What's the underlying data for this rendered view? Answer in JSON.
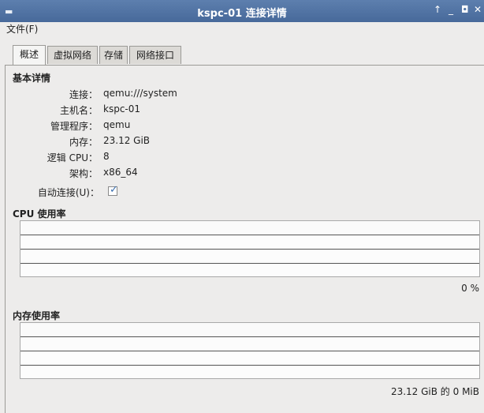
{
  "window": {
    "title": "kspc-01 连接详情",
    "menu_icon": "menu-icon",
    "controls": [
      "↑",
      "_",
      "◘",
      "✕"
    ]
  },
  "menubar": {
    "file": "文件(F)"
  },
  "tabs": [
    "概述",
    "虚拟网络",
    "存储",
    "网络接口"
  ],
  "basic": {
    "title": "基本详情",
    "rows": [
      {
        "label": "连接：",
        "value": "qemu:///system"
      },
      {
        "label": "主机名：",
        "value": "kspc-01"
      },
      {
        "label": "管理程序：",
        "value": "qemu"
      },
      {
        "label": "内存：",
        "value": "23.12 GiB"
      },
      {
        "label": "逻辑 CPU：",
        "value": "8"
      },
      {
        "label": "架构：",
        "value": "x86_64"
      }
    ],
    "autoconnect_label": "自动连接(U)：",
    "autoconnect_checked": true
  },
  "cpu": {
    "title": "CPU 使用率",
    "readout": "0 %"
  },
  "memory": {
    "title": "内存使用率",
    "readout": "23.12 GiB 的  0 MiB"
  }
}
